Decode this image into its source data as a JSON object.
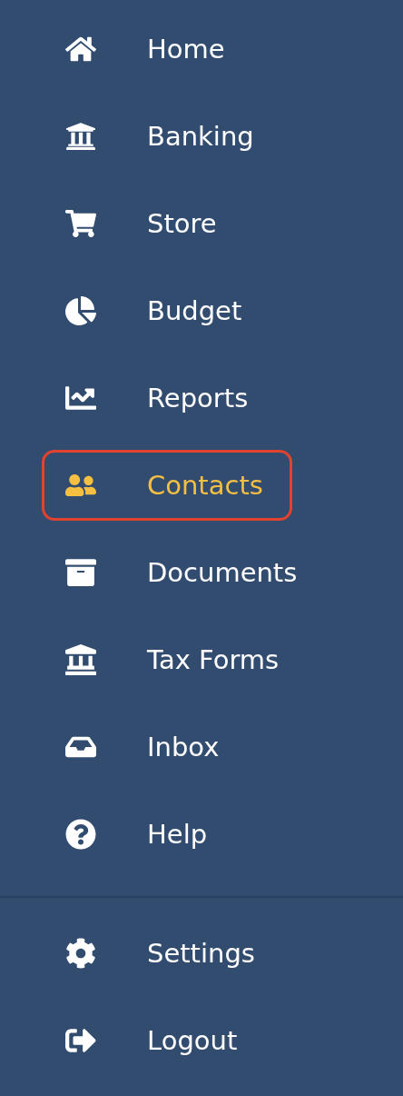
{
  "sidebar": {
    "items": [
      {
        "label": "Home",
        "selected": false
      },
      {
        "label": "Banking",
        "selected": false
      },
      {
        "label": "Store",
        "selected": false
      },
      {
        "label": "Budget",
        "selected": false
      },
      {
        "label": "Reports",
        "selected": false
      },
      {
        "label": "Contacts",
        "selected": true
      },
      {
        "label": "Documents",
        "selected": false
      },
      {
        "label": "Tax Forms",
        "selected": false
      },
      {
        "label": "Inbox",
        "selected": false
      },
      {
        "label": "Help",
        "selected": false
      }
    ],
    "footer_items": [
      {
        "label": "Settings",
        "selected": false
      },
      {
        "label": "Logout",
        "selected": false
      }
    ]
  }
}
